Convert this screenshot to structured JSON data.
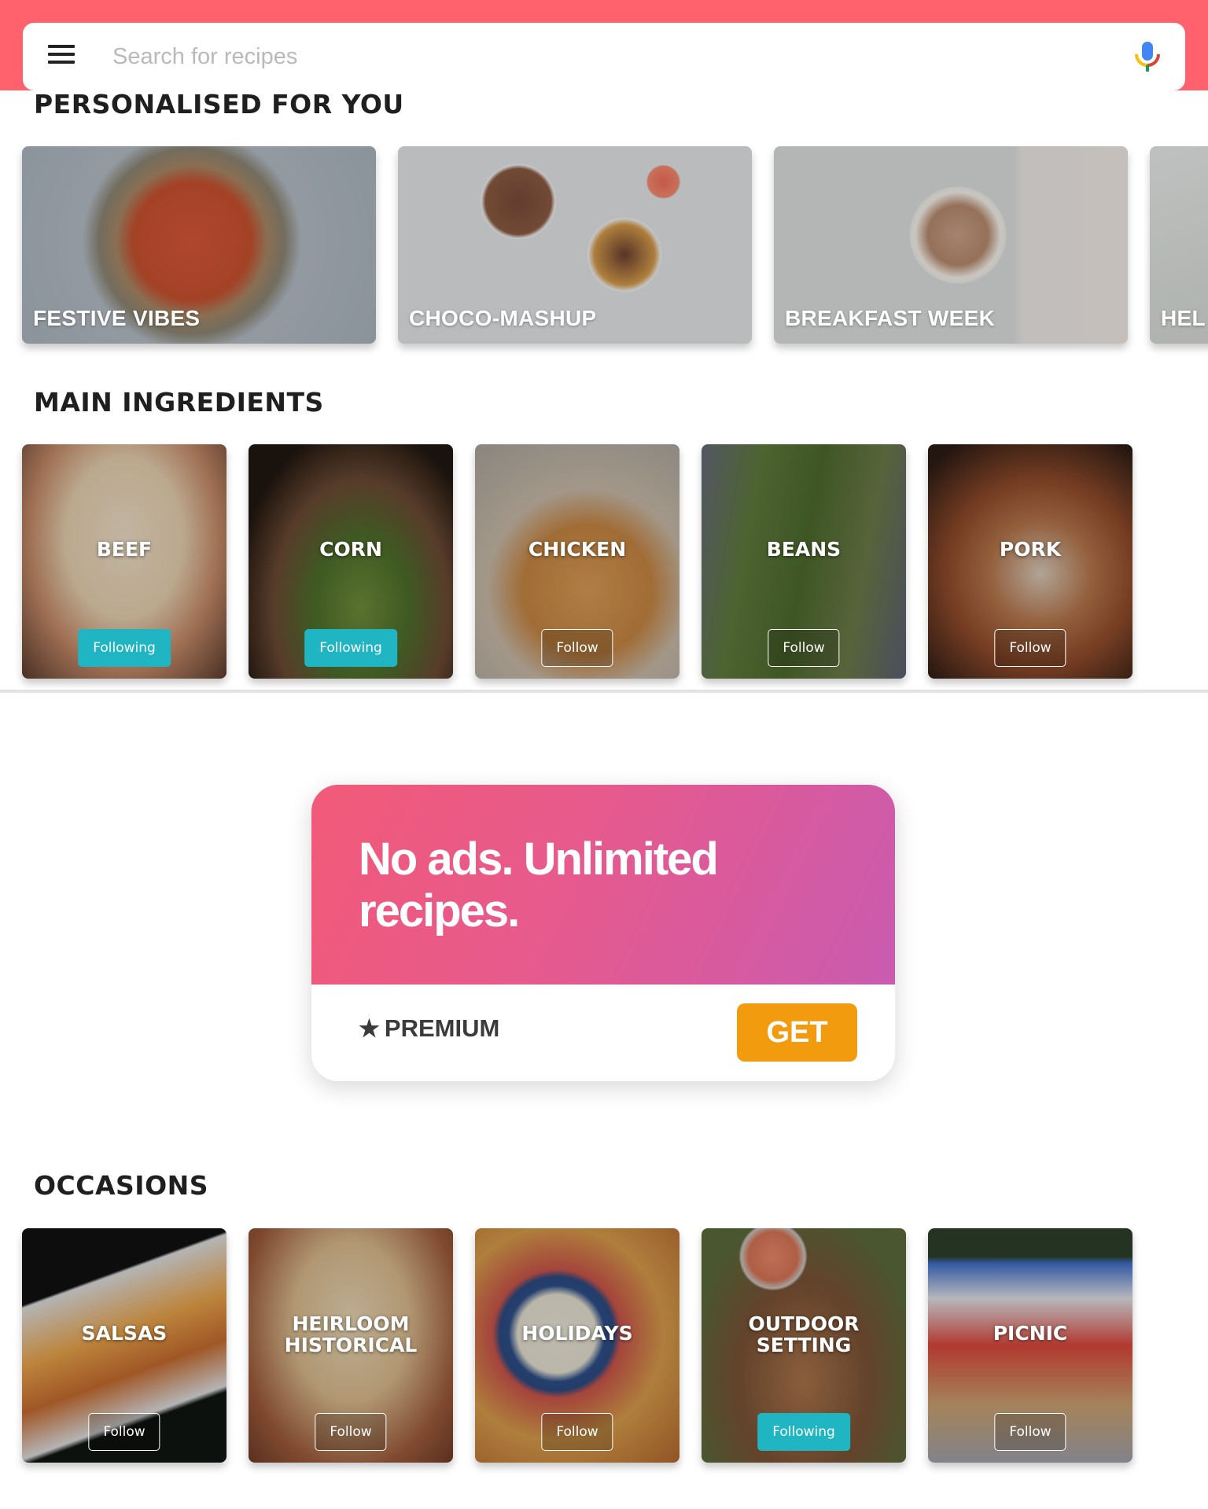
{
  "search": {
    "placeholder": "Search for recipes",
    "value": "",
    "menu_icon": "hamburger-menu-icon",
    "mic_icon": "microphone-icon"
  },
  "sections": {
    "personalised": {
      "title": "PERSONALISED FOR YOU",
      "cards": [
        {
          "label": "FESTIVE VIBES"
        },
        {
          "label": "CHOCO-MASHUP"
        },
        {
          "label": "BREAKFAST WEEK"
        },
        {
          "label": "HEL"
        }
      ]
    },
    "ingredients": {
      "title": "MAIN INGREDIENTS",
      "cards": [
        {
          "label": "BEEF",
          "button": "Following",
          "following": true
        },
        {
          "label": "CORN",
          "button": "Following",
          "following": true
        },
        {
          "label": "CHICKEN",
          "button": "Follow",
          "following": false
        },
        {
          "label": "BEANS",
          "button": "Follow",
          "following": false
        },
        {
          "label": "PORK",
          "button": "Follow",
          "following": false
        }
      ]
    },
    "occasions": {
      "title": "OCCASIONS",
      "cards": [
        {
          "label": "SALSAS",
          "button": "Follow",
          "following": false
        },
        {
          "label": "HEIRLOOM HISTORICAL",
          "button": "Follow",
          "following": false
        },
        {
          "label": "HOLIDAYS",
          "button": "Follow",
          "following": false
        },
        {
          "label": "OUTDOOR SETTING",
          "button": "Following",
          "following": true
        },
        {
          "label": "PICNIC",
          "button": "Follow",
          "following": false
        }
      ]
    }
  },
  "premium": {
    "headline": "No ads. Unlimited recipes.",
    "star_icon": "star-icon",
    "label": "PREMIUM",
    "button": "GET"
  },
  "colors": {
    "brand_red": "#ff616d",
    "following_teal": "#1fb5c2",
    "get_orange": "#f39b0f",
    "premium_gradient_start": "#f25a78",
    "premium_gradient_end": "#c95bb0"
  }
}
